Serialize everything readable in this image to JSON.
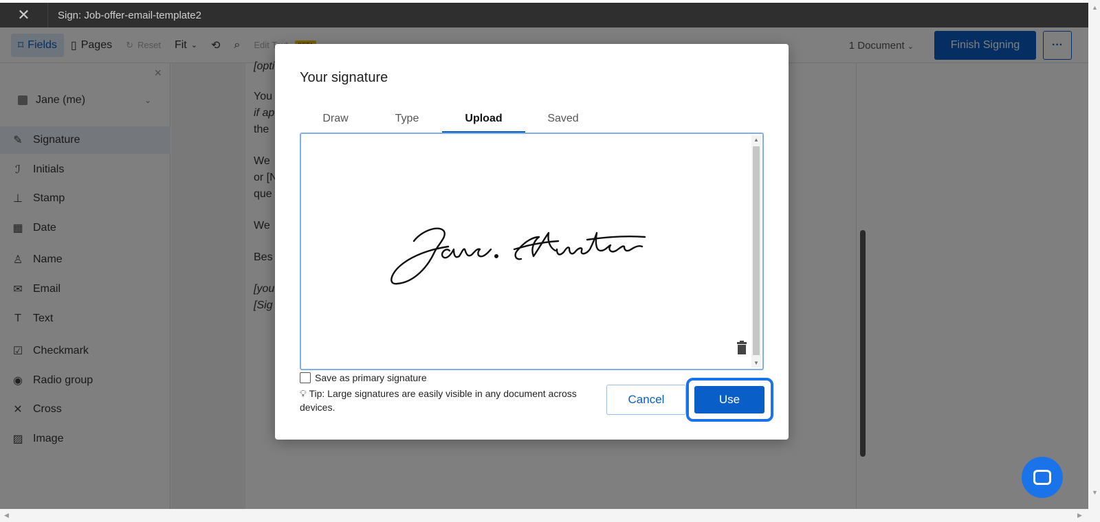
{
  "window": {
    "title": "Sign: Job-offer-email-template2"
  },
  "toolbar": {
    "fields_label": "Fields",
    "pages_label": "Pages",
    "reset_label": "Reset",
    "fit_label": "Fit",
    "edit_text_label": "Edit Text",
    "beta_label": "BETA",
    "documents_label": "1 Document",
    "finish_label": "Finish Signing",
    "more_label": "···"
  },
  "sidebar": {
    "signer": "Jane (me)",
    "items": [
      {
        "label": "Signature",
        "icon": "pen-icon"
      },
      {
        "label": "Initials",
        "icon": "initials-icon"
      },
      {
        "label": "Stamp",
        "icon": "stamp-icon"
      },
      {
        "label": "Date",
        "icon": "calendar-icon"
      },
      {
        "label": "Name",
        "icon": "person-icon"
      },
      {
        "label": "Email",
        "icon": "envelope-icon"
      },
      {
        "label": "Text",
        "icon": "text-icon"
      },
      {
        "label": "Checkmark",
        "icon": "checkbox-icon"
      },
      {
        "label": "Radio group",
        "icon": "radio-icon"
      },
      {
        "label": "Cross",
        "icon": "cross-icon"
      },
      {
        "label": "Image",
        "icon": "image-icon"
      }
    ]
  },
  "document": {
    "lines": [
      "[opti",
      "You",
      "if ap",
      "the",
      "We",
      "or [N",
      "que",
      "We",
      "Bes",
      "[you",
      "[Sig"
    ]
  },
  "modal": {
    "title": "Your signature",
    "tabs": [
      "Draw",
      "Type",
      "Upload",
      "Saved"
    ],
    "active_tab": "Upload",
    "signature_text": "Jane Austen",
    "save_primary_label": "Save as primary signature",
    "tip": "Tip: Large signatures are easily visible in any document across devices.",
    "cancel_label": "Cancel",
    "use_label": "Use"
  },
  "colors": {
    "accent": "#0a5ec7",
    "highlight": "#1a73e8"
  }
}
